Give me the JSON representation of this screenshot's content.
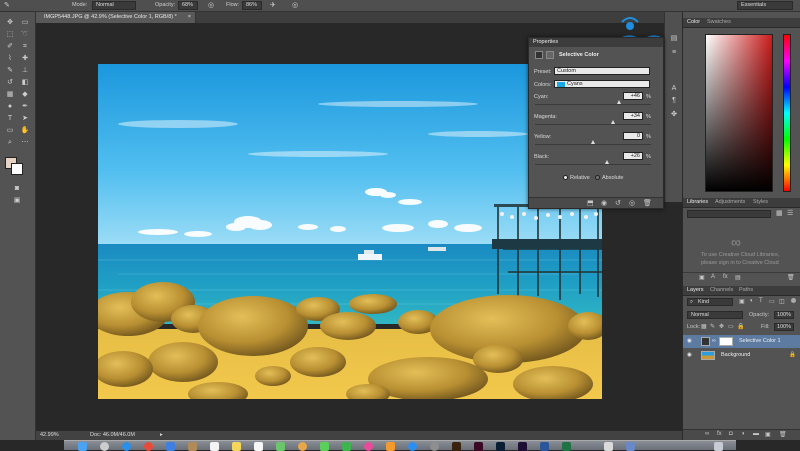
{
  "options_bar": {
    "mode_label": "Mode:",
    "mode_value": "Normal",
    "opacity_label": "Opacity:",
    "opacity_value": "68%",
    "flow_label": "Flow:",
    "flow_value": "86%",
    "workspace": "Essentials"
  },
  "document": {
    "tab_title": "IMGP5448.JPG @ 42.9% (Selective Color 1, RGB/8) *"
  },
  "status": {
    "zoom": "42.99%",
    "doc_info": "Doc: 46.0M/46.0M"
  },
  "watermark": {
    "text": "ntbook",
    "color": "#1e8fe0"
  },
  "color_panel": {
    "tabs": [
      "Color",
      "Swatches"
    ],
    "hue_color": "#cc1c1c"
  },
  "properties": {
    "panel_title": "Properties",
    "adjustment_name": "Selective Color",
    "preset_label": "Preset:",
    "preset_value": "Custom",
    "colors_label": "Colors:",
    "colors_value": "Cyans",
    "sliders": [
      {
        "label": "Cyan:",
        "value": "+46",
        "unit": "%"
      },
      {
        "label": "Magenta:",
        "value": "+34",
        "unit": "%"
      },
      {
        "label": "Yellow:",
        "value": "0",
        "unit": "%"
      },
      {
        "label": "Black:",
        "value": "+26",
        "unit": "%"
      }
    ],
    "mode_relative": "Relative",
    "mode_absolute": "Absolute"
  },
  "libraries": {
    "tabs": [
      "Libraries",
      "Adjustments",
      "Styles"
    ],
    "message_line1": "To use Creative Cloud Libraries,",
    "message_line2": "please sign in to Creative Cloud"
  },
  "layers": {
    "tabs": [
      "Layers",
      "Channels",
      "Paths"
    ],
    "filter_value": "Kind",
    "blend_mode": "Normal",
    "opacity_label": "Opacity:",
    "opacity_value": "100%",
    "lock_label": "Lock:",
    "fill_label": "Fill:",
    "fill_value": "100%",
    "items": [
      {
        "name": "Selective Color 1"
      },
      {
        "name": "Background"
      }
    ]
  }
}
